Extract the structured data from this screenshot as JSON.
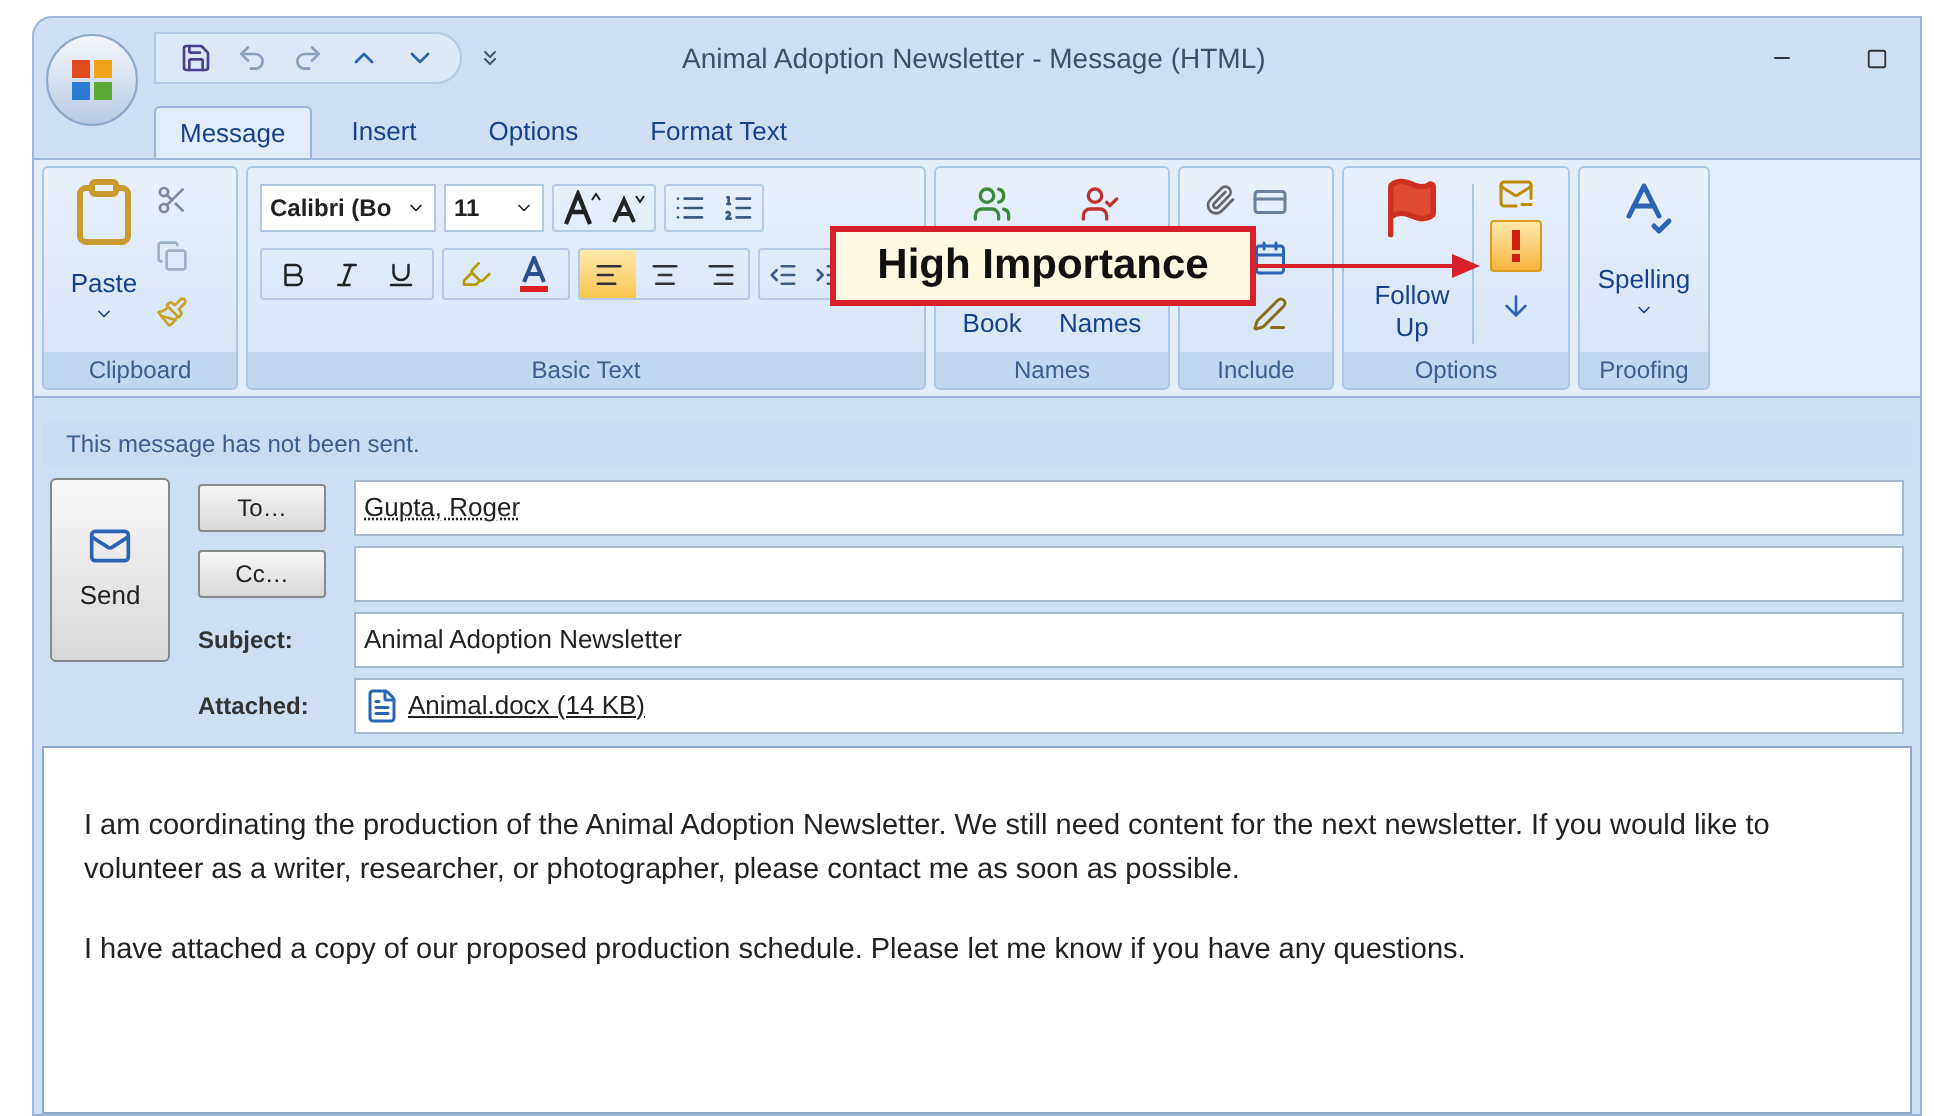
{
  "window": {
    "title": "Animal Adoption Newsletter - Message (HTML)"
  },
  "tabs": [
    {
      "label": "Message",
      "selected": true
    },
    {
      "label": "Insert",
      "selected": false
    },
    {
      "label": "Options",
      "selected": false
    },
    {
      "label": "Format Text",
      "selected": false
    }
  ],
  "ribbon": {
    "clipboard": {
      "label": "Clipboard",
      "paste": "Paste"
    },
    "basic_text": {
      "label": "Basic Text",
      "font": "Calibri (Bo",
      "size": "11",
      "alignment": [
        {
          "kind": "left",
          "selected": true
        },
        {
          "kind": "center",
          "selected": false
        },
        {
          "kind": "right",
          "selected": false
        }
      ]
    },
    "names": {
      "label": "Names",
      "buttons": [
        "Book",
        "Names"
      ]
    },
    "include": {
      "label": "Include"
    },
    "options": {
      "label": "Options",
      "follow_up": "Follow Up",
      "importance": [
        {
          "kind": "high",
          "selected": true
        },
        {
          "kind": "low",
          "selected": false
        }
      ]
    },
    "proofing": {
      "label": "Proofing",
      "spelling": "Spelling"
    }
  },
  "callout": {
    "text": "High Importance"
  },
  "info_bar": "This message has not been sent.",
  "send": "Send",
  "fields": [
    {
      "kind": "button",
      "label": "To…",
      "value": "Gupta, Roger"
    },
    {
      "kind": "button",
      "label": "Cc…"
    },
    {
      "kind": "label",
      "label": "Subject:",
      "value": "Animal Adoption Newsletter"
    },
    {
      "kind": "attachment",
      "label": "Attached:",
      "value": "Animal.docx (14 KB)"
    }
  ],
  "body": [
    "I am coordinating the production of the Animal Adoption Newsletter. We still need content for the next newsletter. If you would like to volunteer as a writer, researcher, or photographer, please contact me as soon as possible.",
    "I have attached a copy of our proposed production schedule. Please let me know if you have any questions."
  ]
}
